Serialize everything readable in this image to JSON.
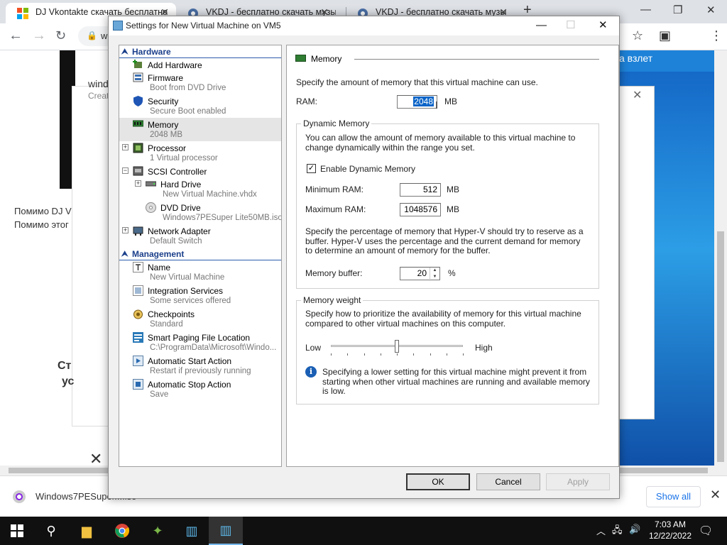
{
  "browser": {
    "tabs": [
      {
        "title": "DJ Vkontakte скачать бесплатно",
        "active": true
      },
      {
        "title": "VKDJ - бесплатно скачать музы",
        "active": false
      },
      {
        "title": "VKDJ - бесплатно скачать музы",
        "active": false
      }
    ],
    "url_partial": "w"
  },
  "page": {
    "blue_banner": "а взлет",
    "frame_snippet_1": "wind",
    "frame_snippet_2": "Creat",
    "text_line_1": "Помимо DJ V",
    "text_line_2": "Помимо этог",
    "bold_line_1": "Ст",
    "bold_line_2": "ус"
  },
  "download_bar": {
    "file_name": "Windows7PESuper....iso",
    "show_all": "Show all"
  },
  "taskbar": {
    "time": "7:03 AM",
    "date": "12/22/2022"
  },
  "dialog": {
    "title": "Settings for New Virtual Machine on VM5",
    "sections": {
      "hardware": "Hardware",
      "management": "Management"
    },
    "tree": [
      {
        "label": "Add Hardware",
        "sub": ""
      },
      {
        "label": "Firmware",
        "sub": "Boot from DVD Drive"
      },
      {
        "label": "Security",
        "sub": "Secure Boot enabled"
      },
      {
        "label": "Memory",
        "sub": "2048 MB"
      },
      {
        "label": "Processor",
        "sub": "1 Virtual processor"
      },
      {
        "label": "SCSI Controller",
        "sub": ""
      },
      {
        "label": "Hard Drive",
        "sub": "New Virtual Machine.vhdx"
      },
      {
        "label": "DVD Drive",
        "sub": "Windows7PESuper Lite50MB.iso"
      },
      {
        "label": "Network Adapter",
        "sub": "Default Switch"
      },
      {
        "label": "Name",
        "sub": "New Virtual Machine"
      },
      {
        "label": "Integration Services",
        "sub": "Some services offered"
      },
      {
        "label": "Checkpoints",
        "sub": "Standard"
      },
      {
        "label": "Smart Paging File Location",
        "sub": "C:\\ProgramData\\Microsoft\\Windo..."
      },
      {
        "label": "Automatic Start Action",
        "sub": "Restart if previously running"
      },
      {
        "label": "Automatic Stop Action",
        "sub": "Save"
      }
    ],
    "memory": {
      "header": "Memory",
      "intro": "Specify the amount of memory that this virtual machine can use.",
      "ram_label": "RAM:",
      "ram_value": "2048",
      "unit": "MB",
      "dynamic_legend": "Dynamic Memory",
      "dynamic_text": "You can allow the amount of memory available to this virtual machine to change dynamically within the range you set.",
      "enable_label": "Enable Dynamic Memory",
      "enable_checked": true,
      "min_label": "Minimum RAM:",
      "min_value": "512",
      "max_label": "Maximum RAM:",
      "max_value": "1048576",
      "buffer_text": "Specify the percentage of memory that Hyper-V should try to reserve as a buffer. Hyper-V uses the percentage and the current demand for memory to determine an amount of memory for the buffer.",
      "buffer_label": "Memory buffer:",
      "buffer_value": "20",
      "percent": "%",
      "weight_legend": "Memory weight",
      "weight_text": "Specify how to prioritize the availability of memory for this virtual machine compared to other virtual machines on this computer.",
      "low": "Low",
      "high": "High",
      "weight_level": 0.5,
      "info_text": "Specifying a lower setting for this virtual machine might prevent it from starting when other virtual machines are running and available memory is low."
    },
    "buttons": {
      "ok": "OK",
      "cancel": "Cancel",
      "apply": "Apply"
    }
  }
}
